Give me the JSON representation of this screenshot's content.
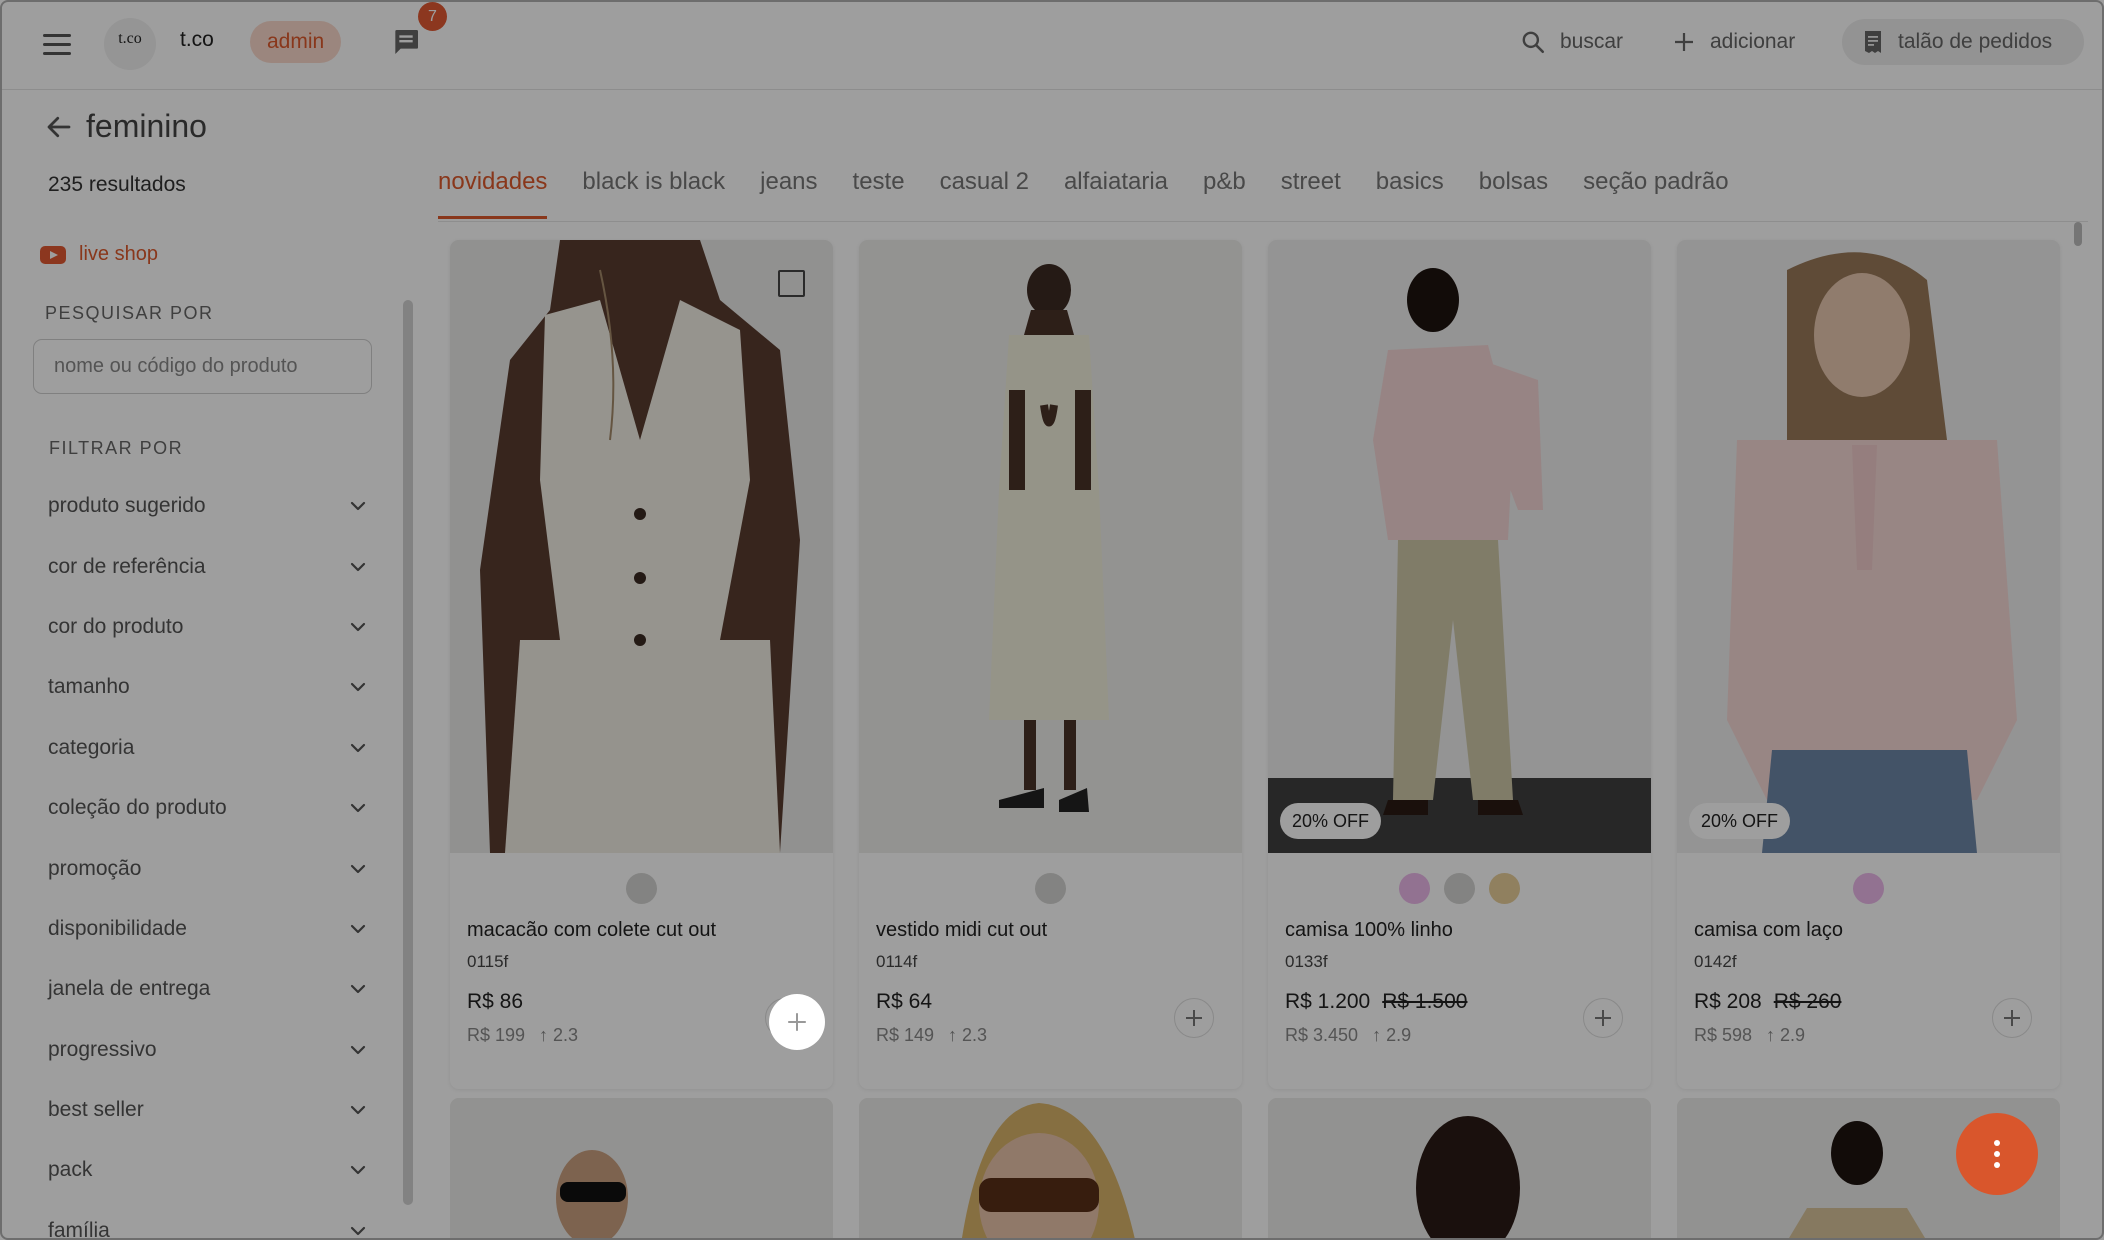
{
  "header": {
    "logo_text": "t.co",
    "brand": "t.co",
    "admin_label": "admin",
    "chat_badge": "7",
    "search_label": "buscar",
    "add_label": "adicionar",
    "orders_label": "talão de pedidos"
  },
  "sidebar": {
    "title": "feminino",
    "results": "235 resultados",
    "live_shop": "live shop",
    "search_section": "PESQUISAR POR",
    "search_placeholder": "nome ou código do produto",
    "filter_section": "FILTRAR POR",
    "filters": [
      "produto sugerido",
      "cor de referência",
      "cor do produto",
      "tamanho",
      "categoria",
      "coleção do produto",
      "promoção",
      "disponibilidade",
      "janela de entrega",
      "progressivo",
      "best seller",
      "pack",
      "família"
    ]
  },
  "tabs": [
    "novidades",
    "black is black",
    "jeans",
    "teste",
    "casual 2",
    "alfaiataria",
    "p&b",
    "street",
    "basics",
    "bolsas",
    "seção padrão"
  ],
  "active_tab": "novidades",
  "products": [
    {
      "name": "macacão com colete cut out",
      "code": "0115f",
      "price": "R$ 86",
      "old_price": "",
      "retail": "R$ 199",
      "markup": "2.3",
      "discount": "",
      "swatches": [
        "#d4d4d2"
      ]
    },
    {
      "name": "vestido midi cut out",
      "code": "0114f",
      "price": "R$ 64",
      "old_price": "",
      "retail": "R$ 149",
      "markup": "2.3",
      "discount": "",
      "swatches": [
        "#d4d4d2"
      ]
    },
    {
      "name": "camisa 100% linho",
      "code": "0133f",
      "price": "R$ 1.200",
      "old_price": "R$ 1.500",
      "retail": "R$ 3.450",
      "markup": "2.9",
      "discount": "20% OFF",
      "swatches": [
        "#ecb8ea",
        "#d4d4d2",
        "#e8cf9a"
      ]
    },
    {
      "name": "camisa com laço",
      "code": "0142f",
      "price": "R$ 208",
      "old_price": "R$ 260",
      "retail": "R$ 598",
      "markup": "2.9",
      "discount": "20% OFF",
      "swatches": [
        "#ecb8ea"
      ]
    }
  ],
  "colors": {
    "accent": "#dd5a2c",
    "overlay": "rgba(0,0,0,0.38)"
  }
}
